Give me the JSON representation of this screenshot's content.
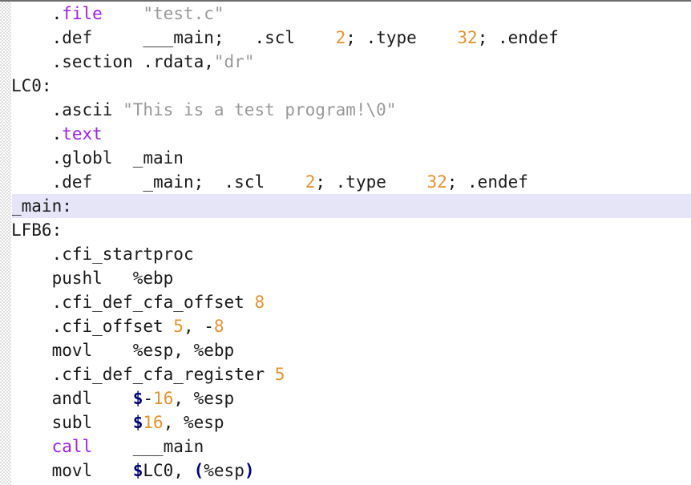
{
  "editor": {
    "title": "assembly-listing",
    "language": "gas-assembly",
    "highlighted_line_index": 8,
    "colors": {
      "background": "#ffffff",
      "foreground": "#1a1a1a",
      "keyword": "#a020f0",
      "string": "#9a9a9a",
      "number": "#e8932a",
      "punctuation": "#00007f",
      "current_line_highlight": "#e5e5f7",
      "gutter": "#fdfdfd"
    }
  },
  "lines": [
    {
      "id": "line-1",
      "indent": true,
      "highlight": false,
      "tokens": [
        {
          "t": ".",
          "c": "plain"
        },
        {
          "t": "file",
          "c": "kw"
        },
        {
          "t": "    ",
          "c": "plain"
        },
        {
          "t": "\"test.c\"",
          "c": "str"
        }
      ]
    },
    {
      "id": "line-2",
      "indent": true,
      "highlight": false,
      "tokens": [
        {
          "t": ".def",
          "c": "plain"
        },
        {
          "t": "     ",
          "c": "plain"
        },
        {
          "t": "___main;",
          "c": "plain"
        },
        {
          "t": "   ",
          "c": "plain"
        },
        {
          "t": ".scl",
          "c": "plain"
        },
        {
          "t": "    ",
          "c": "plain"
        },
        {
          "t": "2",
          "c": "num"
        },
        {
          "t": ";",
          "c": "plain"
        },
        {
          "t": " ",
          "c": "plain"
        },
        {
          "t": ".type",
          "c": "plain"
        },
        {
          "t": "    ",
          "c": "plain"
        },
        {
          "t": "32",
          "c": "num"
        },
        {
          "t": "; .endef",
          "c": "plain"
        }
      ]
    },
    {
      "id": "line-3",
      "indent": true,
      "highlight": false,
      "tokens": [
        {
          "t": ".section ",
          "c": "plain"
        },
        {
          "t": ".rdata,",
          "c": "plain"
        },
        {
          "t": "\"dr\"",
          "c": "str"
        }
      ]
    },
    {
      "id": "line-4",
      "indent": false,
      "highlight": false,
      "tokens": [
        {
          "t": "LC0:",
          "c": "label"
        }
      ]
    },
    {
      "id": "line-5",
      "indent": true,
      "highlight": false,
      "tokens": [
        {
          "t": ".ascii ",
          "c": "plain"
        },
        {
          "t": "\"This is a test program!\\0\"",
          "c": "str"
        }
      ]
    },
    {
      "id": "line-6",
      "indent": true,
      "highlight": false,
      "tokens": [
        {
          "t": ".",
          "c": "plain"
        },
        {
          "t": "text",
          "c": "kw"
        }
      ]
    },
    {
      "id": "line-7",
      "indent": true,
      "highlight": false,
      "tokens": [
        {
          "t": ".globl ",
          "c": "plain"
        },
        {
          "t": " _main",
          "c": "plain"
        }
      ]
    },
    {
      "id": "line-8",
      "indent": true,
      "highlight": false,
      "tokens": [
        {
          "t": ".def",
          "c": "plain"
        },
        {
          "t": "     ",
          "c": "plain"
        },
        {
          "t": "_main;",
          "c": "plain"
        },
        {
          "t": "  ",
          "c": "plain"
        },
        {
          "t": ".scl",
          "c": "plain"
        },
        {
          "t": "    ",
          "c": "plain"
        },
        {
          "t": "2",
          "c": "num"
        },
        {
          "t": ";",
          "c": "plain"
        },
        {
          "t": " ",
          "c": "plain"
        },
        {
          "t": ".type",
          "c": "plain"
        },
        {
          "t": "    ",
          "c": "plain"
        },
        {
          "t": "32",
          "c": "num"
        },
        {
          "t": "; .endef",
          "c": "plain"
        }
      ]
    },
    {
      "id": "line-9",
      "indent": false,
      "highlight": true,
      "tokens": [
        {
          "t": "_main:",
          "c": "label"
        }
      ]
    },
    {
      "id": "line-10",
      "indent": false,
      "highlight": false,
      "tokens": [
        {
          "t": "LFB6:",
          "c": "label"
        }
      ]
    },
    {
      "id": "line-11",
      "indent": true,
      "highlight": false,
      "tokens": [
        {
          "t": ".cfi_startproc",
          "c": "plain"
        }
      ]
    },
    {
      "id": "line-12",
      "indent": true,
      "highlight": false,
      "tokens": [
        {
          "t": "pushl",
          "c": "plain"
        },
        {
          "t": "   ",
          "c": "plain"
        },
        {
          "t": "%ebp",
          "c": "plain"
        }
      ]
    },
    {
      "id": "line-13",
      "indent": true,
      "highlight": false,
      "tokens": [
        {
          "t": ".cfi_def_cfa_offset ",
          "c": "plain"
        },
        {
          "t": "8",
          "c": "num"
        }
      ]
    },
    {
      "id": "line-14",
      "indent": true,
      "highlight": false,
      "tokens": [
        {
          "t": ".cfi_offset ",
          "c": "plain"
        },
        {
          "t": "5",
          "c": "num"
        },
        {
          "t": ", ",
          "c": "plain"
        },
        {
          "t": "-",
          "c": "plain"
        },
        {
          "t": "8",
          "c": "num"
        }
      ]
    },
    {
      "id": "line-15",
      "indent": true,
      "highlight": false,
      "tokens": [
        {
          "t": "movl",
          "c": "plain"
        },
        {
          "t": "    ",
          "c": "plain"
        },
        {
          "t": "%esp, %ebp",
          "c": "plain"
        }
      ]
    },
    {
      "id": "line-16",
      "indent": true,
      "highlight": false,
      "tokens": [
        {
          "t": ".cfi_def_cfa_register ",
          "c": "plain"
        },
        {
          "t": "5",
          "c": "num"
        }
      ]
    },
    {
      "id": "line-17",
      "indent": true,
      "highlight": false,
      "tokens": [
        {
          "t": "andl",
          "c": "plain"
        },
        {
          "t": "    ",
          "c": "plain"
        },
        {
          "t": "$",
          "c": "punct"
        },
        {
          "t": "-",
          "c": "plain"
        },
        {
          "t": "16",
          "c": "num"
        },
        {
          "t": ", %esp",
          "c": "plain"
        }
      ]
    },
    {
      "id": "line-18",
      "indent": true,
      "highlight": false,
      "tokens": [
        {
          "t": "subl",
          "c": "plain"
        },
        {
          "t": "    ",
          "c": "plain"
        },
        {
          "t": "$",
          "c": "punct"
        },
        {
          "t": "16",
          "c": "num"
        },
        {
          "t": ", %esp",
          "c": "plain"
        }
      ]
    },
    {
      "id": "line-19",
      "indent": true,
      "highlight": false,
      "tokens": [
        {
          "t": "call",
          "c": "kw"
        },
        {
          "t": "    ",
          "c": "plain"
        },
        {
          "t": "___main",
          "c": "plain"
        }
      ]
    },
    {
      "id": "line-20",
      "indent": true,
      "highlight": false,
      "tokens": [
        {
          "t": "movl",
          "c": "plain"
        },
        {
          "t": "    ",
          "c": "plain"
        },
        {
          "t": "$",
          "c": "punct"
        },
        {
          "t": "LC0, ",
          "c": "plain"
        },
        {
          "t": "(",
          "c": "punct"
        },
        {
          "t": "%esp",
          "c": "plain"
        },
        {
          "t": ")",
          "c": "punct"
        }
      ]
    }
  ]
}
